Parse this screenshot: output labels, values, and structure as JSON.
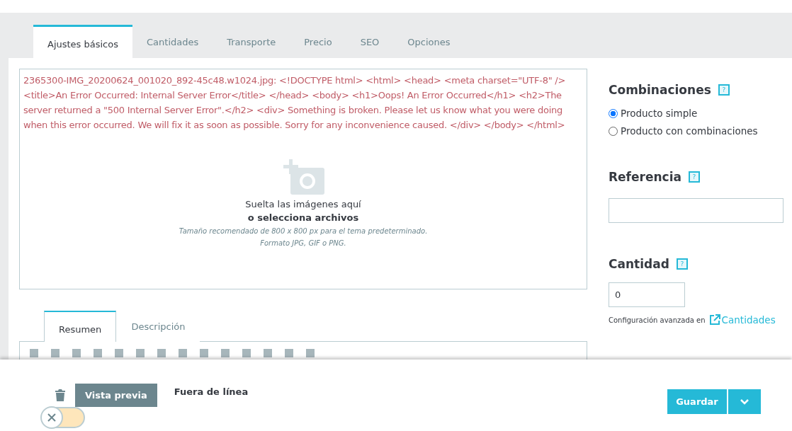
{
  "tabs": [
    {
      "label": "Ajustes básicos",
      "selected": true
    },
    {
      "label": "Cantidades",
      "selected": false
    },
    {
      "label": "Transporte",
      "selected": false
    },
    {
      "label": "Precio",
      "selected": false
    },
    {
      "label": "SEO",
      "selected": false
    },
    {
      "label": "Opciones",
      "selected": false
    }
  ],
  "upload": {
    "error": "2365300-IMG_20200624_001020_892-45c48.w1024.jpg: <!DOCTYPE html> <html> <head> <meta charset=\"UTF-8\" /> <title>An Error Occurred: Internal Server Error</title> </head> <body> <h1>Oops! An Error Occurred</h1> <h2>The server returned a \"500 Internal Server Error\".</h2> <div> Something is broken. Please let us know what you were doing when this error occurred. We will fix it as soon as possible. Sorry for any inconvenience caused. </div> </body> </html>",
    "drop_text": "Suelta las imágenes aquí",
    "select_text": "o selecciona archivos",
    "hint_size": "Tamaño recomendado de 800 x 800 px para el tema predeterminado.",
    "hint_format": "Formato JPG, GIF o PNG."
  },
  "description_tabs": [
    {
      "label": "Resumen",
      "selected": true
    },
    {
      "label": "Descripción",
      "selected": false
    }
  ],
  "combinations": {
    "title": "Combinaciones",
    "help": "?",
    "options": [
      {
        "label": "Producto simple",
        "selected": true
      },
      {
        "label": "Producto con combinaciones",
        "selected": false
      }
    ]
  },
  "reference": {
    "title": "Referencia",
    "help": "?"
  },
  "quantity": {
    "title": "Cantidad",
    "help": "?",
    "value": "0",
    "advanced_text": "Configuración avanzada en",
    "advanced_link": "Cantidades"
  },
  "footer": {
    "preview_button": "Vista previa",
    "status": "Fuera de línea",
    "online_toggle": {
      "on": false
    },
    "save_button": "Guardar"
  }
}
